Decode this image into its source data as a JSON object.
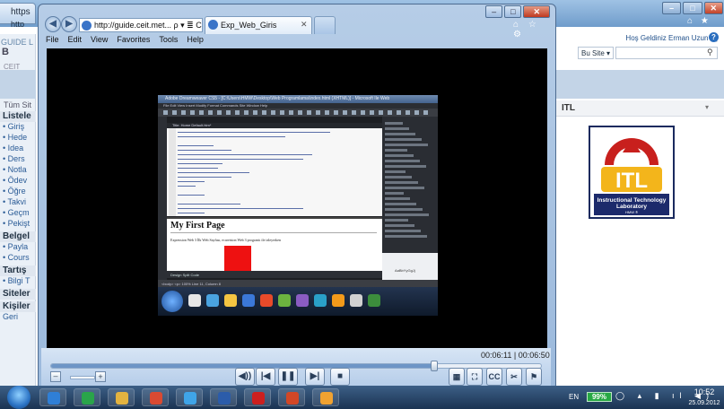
{
  "outer_browser": {
    "tab_title": "https",
    "tab2_title": "http",
    "left_site": {
      "header": "GUIDE L",
      "logo": "B",
      "subtitle": "CEIT",
      "quick_launch": "Tüm Sit",
      "menu": [
        {
          "type": "header",
          "label": "Listele"
        },
        {
          "type": "item",
          "label": "• Giriş"
        },
        {
          "type": "item",
          "label": "• Hede"
        },
        {
          "type": "item",
          "label": "• Idea"
        },
        {
          "type": "item",
          "label": "• Ders"
        },
        {
          "type": "item",
          "label": "• Notla"
        },
        {
          "type": "item",
          "label": "• Ödev"
        },
        {
          "type": "item",
          "label": "• Öğre"
        },
        {
          "type": "item",
          "label": "• Takvi"
        },
        {
          "type": "item",
          "label": "• Geçm"
        },
        {
          "type": "item",
          "label": "• Pekişt"
        },
        {
          "type": "header",
          "label": "Belgel"
        },
        {
          "type": "item",
          "label": "• Payla"
        },
        {
          "type": "item",
          "label": "• Cours"
        },
        {
          "type": "header",
          "label": "Tartış"
        },
        {
          "type": "item",
          "label": "• Bilgi T"
        },
        {
          "type": "header",
          "label": "Siteler"
        },
        {
          "type": "header",
          "label": "Kişiler"
        },
        {
          "type": "item",
          "label": "Geri"
        }
      ]
    },
    "right_site": {
      "greeting": "Hoş Geldiniz Erman Uzun ▾ |",
      "help_glyph": "?",
      "scope_select": "Bu Site ▾",
      "search_glyph": "⚲",
      "webpart_title": "ITL",
      "webpart_chevron": "▾",
      "logo": {
        "text": "ITL",
        "caption_line1": "Instructional Technology",
        "caption_line2": "Laboratory",
        "caption_line3": "HMW ®"
      }
    },
    "tools_glyphs": "⌂ ★",
    "window_controls": [
      "–",
      "□",
      "✕"
    ]
  },
  "player": {
    "window_controls": [
      "–",
      "□",
      "✕"
    ],
    "inner_browser": {
      "address": "http://guide.ceit.met... ρ ▾ ≣ C ✕",
      "tab_title": "Exp_Web_Giris",
      "tab_close": "✕",
      "right_glyphs": "⌂ ☆ ⚙",
      "menu": [
        "File",
        "Edit",
        "View",
        "Favorites",
        "Tools",
        "Help"
      ]
    },
    "video_frame": {
      "title_bar": "Adobe Dreamweaver CS5 - [C:\\Users\\HMW\\Desktop\\Web Programlama\\index.html (XHTML)] - Microsoft Ile Web",
      "menu_bar": "File  Edit  View  Insert  Modify  Format  Commands  Site  Window  Help",
      "doc_tab": "Title: Home   Default.htm*",
      "design_heading": "My First Page",
      "design_paragraph": "Expression Web 3 İlk Web Sayfası, ecaretsion Web 3 prograniı ile izleyerken",
      "design_tabs": "Design   Split   Code",
      "status_bar": "<body>   <p>   100%   Line 11, Column 8",
      "properties_text": "AaBbYyGgJj"
    },
    "time": "00:06:11 | 00:06:50",
    "progress_fraction": 0.785,
    "zoom_in_glyph": "+",
    "restore_glyph": "–",
    "controls": [
      {
        "name": "volume-button",
        "label": "◀))"
      },
      {
        "name": "previous-button",
        "label": "|◀"
      },
      {
        "name": "pause-button",
        "label": "❚❚"
      },
      {
        "name": "next-button",
        "label": "▶|"
      },
      {
        "name": "stop-button",
        "label": "■"
      }
    ],
    "right_controls": [
      {
        "name": "layout-button",
        "label": "▦"
      },
      {
        "name": "fullscreen-button",
        "label": "⛶"
      },
      {
        "name": "captions-button",
        "label": "CC"
      },
      {
        "name": "slides-button",
        "label": "✂"
      },
      {
        "name": "flag-button",
        "label": "⚑"
      }
    ]
  },
  "taskbar": {
    "language": "EN",
    "battery": "99%",
    "tray_icons": "◯ ▴ ▮ ıl ◀)",
    "time": "10:52",
    "date": "25.09.2012",
    "apps": [
      "ie-icon",
      "media-center-icon",
      "explorer-folder-icon",
      "chrome-icon",
      "messenger-icon",
      "word-icon",
      "opera-icon",
      "powerpoint-icon",
      "windows-media-icon"
    ],
    "colors": {
      "ie": "#2f7fd6",
      "media-center": "#2aa44a",
      "explorer": "#e3b340",
      "chrome": "#d94a32",
      "messenger": "#3fa4e8",
      "word": "#2b5caa",
      "opera": "#cc1f1f",
      "powerpoint": "#d24726",
      "windows-media": "#f0a231"
    }
  }
}
